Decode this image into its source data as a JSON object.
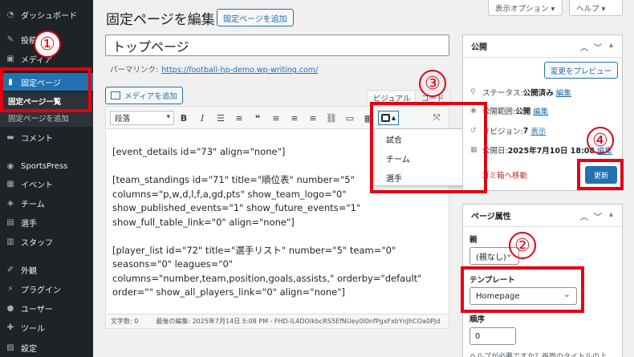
{
  "sidebar": {
    "items": [
      {
        "label": "ダッシュボード",
        "icon": "dashboard-icon",
        "glyph": "◔"
      },
      {
        "label": "投稿",
        "icon": "pin-icon",
        "glyph": "✎"
      },
      {
        "label": "メディア",
        "icon": "media-icon",
        "glyph": "▣"
      },
      {
        "label": "固定ページ",
        "icon": "page-icon",
        "glyph": "▮"
      },
      {
        "label": "コメント",
        "icon": "comment-icon",
        "glyph": "▬"
      },
      {
        "label": "SportsPress",
        "icon": "sportspress-icon",
        "glyph": "◉"
      },
      {
        "label": "イベント",
        "icon": "calendar-icon",
        "glyph": "▦"
      },
      {
        "label": "チーム",
        "icon": "shield-icon",
        "glyph": "◈"
      },
      {
        "label": "選手",
        "icon": "player-icon",
        "glyph": "▤"
      },
      {
        "label": "スタッフ",
        "icon": "staff-icon",
        "glyph": "▥"
      },
      {
        "label": "外観",
        "icon": "brush-icon",
        "glyph": "✐"
      },
      {
        "label": "プラグイン",
        "icon": "plugin-icon",
        "glyph": "⚡"
      },
      {
        "label": "ユーザー",
        "icon": "user-icon",
        "glyph": "●"
      },
      {
        "label": "ツール",
        "icon": "wrench-icon",
        "glyph": "✚"
      },
      {
        "label": "設定",
        "icon": "settings-icon",
        "glyph": "▨"
      }
    ],
    "sub_all": "固定ページ一覧",
    "sub_add": "固定ページを追加"
  },
  "header": {
    "title": "固定ページを編集",
    "add_button": "固定ページを追加",
    "screen_options": "表示オプション ▾",
    "help": "ヘルプ ▾"
  },
  "post": {
    "title": "トップページ",
    "permalink_label": "パーマリンク:",
    "permalink_url": "https://football-hp-demo.wp-writing.com/"
  },
  "editor": {
    "media_button": "メディアを追加",
    "tab_visual": "ビジュアル",
    "tab_code": "コード",
    "format": "段落",
    "content": "[event_details id=\"73\" align=\"none\"]\n\n[team_standings id=\"71\" title=\"順位表\" number=\"5\" columns=\"p,w,d,l,f,a,gd,pts\" show_team_logo=\"0\" show_published_events=\"1\" show_future_events=\"1\" show_full_table_link=\"0\" align=\"none\"]\n\n[player_list id=\"72\" title=\"選手リスト\" number=\"5\" team=\"0\" seasons=\"0\" leagues=\"0\" columns=\"number,team,position,goals,assists,\" orderby=\"default\" order=\"\" show_all_players_link=\"0\" align=\"none\"]",
    "word_count": "文字数: 0",
    "last_edit": "最後の編集: 2025年7月14日 5:08 PM - FHD-lL4DOIkbcRS5EfNUey0I0nfPgxFxbYnJhCOa0PJd"
  },
  "shortcode_menu": [
    "試合",
    "チーム",
    "選手"
  ],
  "publish": {
    "title": "公開",
    "preview": "変更をプレビュー",
    "status_label": "ステータス:",
    "status_value": "公開済み",
    "visibility_label": "公開範囲:",
    "visibility_value": "公開",
    "revisions_label": "リビジョン:",
    "revisions_value": "7",
    "revisions_link": "表示",
    "date_label": "公開日:",
    "date_value": "2025年7月10日 18:08",
    "edit": "編集",
    "trash": "ゴミ箱へ移動",
    "update": "更新"
  },
  "attributes": {
    "title": "ページ属性",
    "parent_label": "親",
    "parent_value": "(親なし)",
    "template_label": "テンプレート",
    "template_value": "Homepage",
    "order_label": "順序",
    "order_value": "0",
    "help_text": "ヘルプが必要ですか？画面のタイトルの上"
  },
  "annotations": [
    "①",
    "②",
    "③",
    "④"
  ],
  "colors": {
    "accent": "#2271b1",
    "annotation": "#e50012",
    "sidebar": "#1d2327"
  }
}
